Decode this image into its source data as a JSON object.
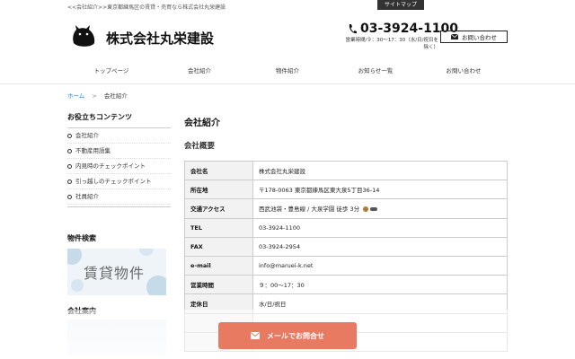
{
  "topbar": {
    "tagline": "<<会社紹介>>東京都練馬区の賃貸・売買なら株式会社丸栄建設",
    "sitemap": "サイトマップ"
  },
  "header": {
    "company": "株式会社丸栄建設",
    "phone": "03-3924-1100",
    "hours": "営業時間/９：30〜17：30（水/日/祝日を除く）",
    "contact_label": "お問い合わせ"
  },
  "nav": {
    "items": [
      "トップページ",
      "会社紹介",
      "物件紹介",
      "お知らせ一覧",
      "お問い合わせ"
    ]
  },
  "breadcrumb": {
    "home": "ホーム",
    "sep": ">",
    "current": "会社紹介"
  },
  "sidebar": {
    "title": "お役立ちコンテンツ",
    "items": [
      "会社紹介",
      "不動産用語集",
      "内見時のチェックポイント",
      "引っ越しのチェックポイント",
      "社員紹介"
    ],
    "search_title": "物件検索",
    "banner_text": "賃貸物件",
    "company_title": "会社案内"
  },
  "main": {
    "title": "会社紹介",
    "subtitle": "会社概要",
    "rows": [
      {
        "key": "会社名",
        "value": "株式会社丸栄建設"
      },
      {
        "key": "所在地",
        "value": "〒178-0063 東京都練馬区東大泉5丁目36-14"
      },
      {
        "key": "交通アクセス",
        "value": "西武池袋・豊島線 / 大泉学園 徒歩 3分"
      },
      {
        "key": "TEL",
        "value": "03-3924-1100"
      },
      {
        "key": "FAX",
        "value": "03-3924-2954"
      },
      {
        "key": "e-mail",
        "value": "info@maruei-k.net"
      },
      {
        "key": "営業時間",
        "value": "９：00〜17：30"
      },
      {
        "key": "定休日",
        "value": "水/日/祝日"
      }
    ]
  },
  "floating": {
    "mail_label": "メールでお問合せ"
  },
  "colors": {
    "accent": "#e87a62",
    "link": "#2a7fc4"
  }
}
